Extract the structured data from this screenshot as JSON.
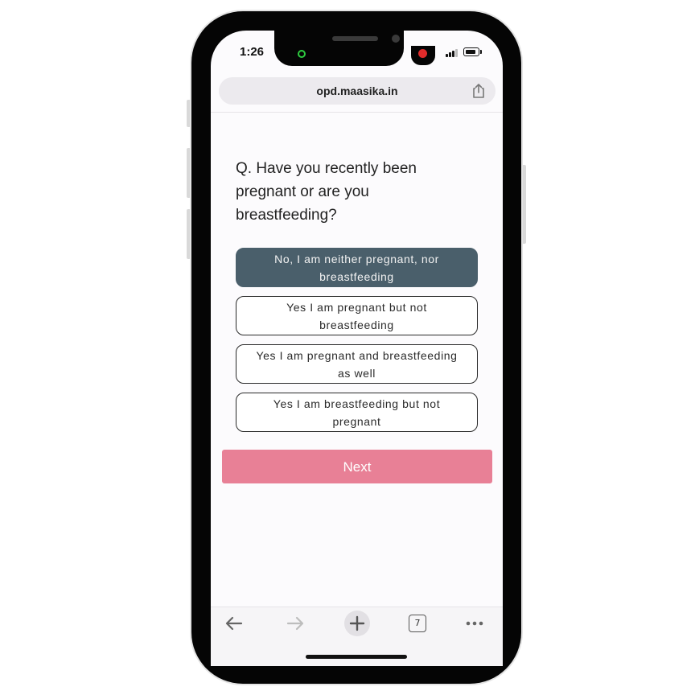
{
  "status_bar": {
    "time": "1:26"
  },
  "browser": {
    "url": "opd.maasika.in",
    "tabs_count": "7"
  },
  "survey": {
    "question": "Q. Have you recently been pregnant or are you breastfeeding?",
    "options": [
      {
        "label": "No, I am neither pregnant, nor breastfeeding",
        "selected": true
      },
      {
        "label": "Yes I am pregnant but not breastfeeding",
        "selected": false
      },
      {
        "label": "Yes I am pregnant and breastfeeding as well",
        "selected": false
      },
      {
        "label": "Yes I am breastfeeding but not pregnant",
        "selected": false
      }
    ],
    "next_label": "Next"
  },
  "icons": {
    "share": "share-icon",
    "back": "arrow-left-icon",
    "forward": "arrow-right-icon",
    "new_tab": "plus-icon",
    "tabs": "tabs-icon",
    "more": "more-icon"
  },
  "colors": {
    "selected_option": "#4a5f6b",
    "next_button": "#e88096",
    "url_bar": "#eceaee"
  }
}
